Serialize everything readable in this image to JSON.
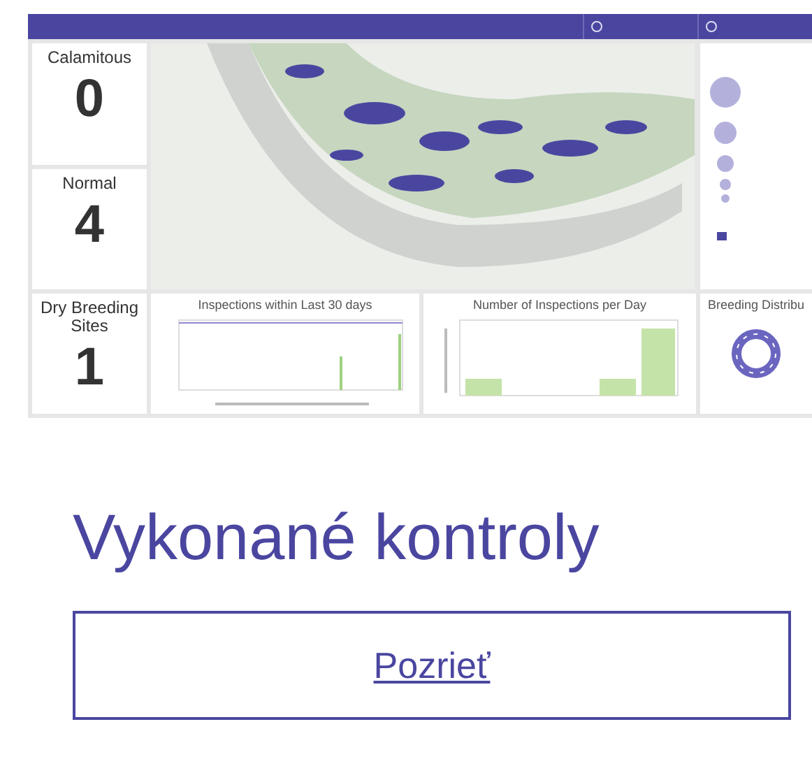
{
  "dashboard": {
    "indicators": [
      {
        "label": "Calamitous",
        "value": "0"
      },
      {
        "label": "Normal",
        "value": "4"
      },
      {
        "label": "Dry Breeding Sites",
        "value": "1"
      }
    ],
    "charts": [
      {
        "kind": "line",
        "title": "Inspections within Last 30 days"
      },
      {
        "kind": "bar",
        "title": "Number of Inspections per Day"
      },
      {
        "kind": "donut",
        "title": "Breeding Distribu"
      }
    ]
  },
  "section": {
    "heading": "Vykonané kontroly",
    "button": "Pozrieť"
  }
}
